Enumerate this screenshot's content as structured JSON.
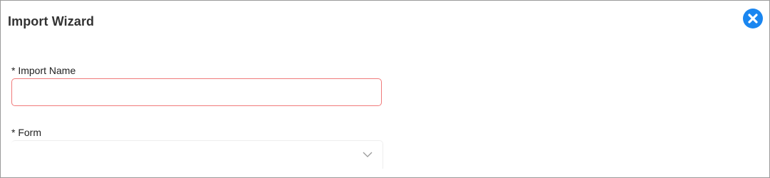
{
  "dialog": {
    "title": "Import Wizard",
    "close_icon": "close-circle-icon",
    "accent_color": "#1a86f0"
  },
  "form": {
    "import_name": {
      "label": "* Import Name",
      "value": "",
      "placeholder": "",
      "state": "invalid",
      "border_color": "#f07a7a"
    },
    "form_select": {
      "label": "* Form",
      "selected": "",
      "icon": "chevron-down-icon"
    }
  }
}
